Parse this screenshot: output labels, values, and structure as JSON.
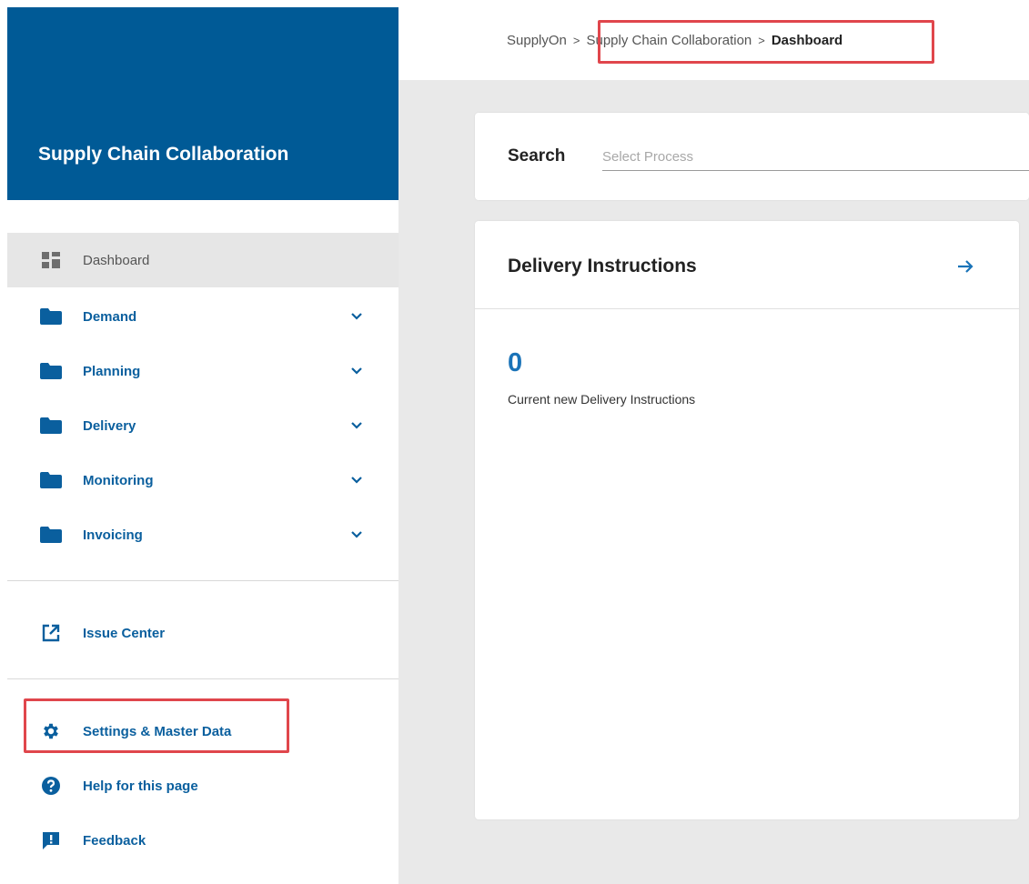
{
  "sidebar": {
    "title": "Supply Chain Collaboration",
    "nav": [
      {
        "label": "Dashboard",
        "icon": "dashboard-icon",
        "active": true
      },
      {
        "label": "Demand",
        "icon": "folder-icon",
        "expandable": true
      },
      {
        "label": "Planning",
        "icon": "folder-icon",
        "expandable": true
      },
      {
        "label": "Delivery",
        "icon": "folder-icon",
        "expandable": true
      },
      {
        "label": "Monitoring",
        "icon": "folder-icon",
        "expandable": true
      },
      {
        "label": "Invoicing",
        "icon": "folder-icon",
        "expandable": true
      }
    ],
    "issue_center": {
      "label": "Issue Center",
      "icon": "external-link-icon"
    },
    "bottom": [
      {
        "label": "Settings & Master Data",
        "icon": "gear-icon"
      },
      {
        "label": "Help for this page",
        "icon": "help-icon"
      },
      {
        "label": "Feedback",
        "icon": "feedback-icon"
      }
    ]
  },
  "breadcrumb": {
    "items": [
      "SupplyOn",
      "Supply Chain Collaboration",
      "Dashboard"
    ],
    "separator": ">"
  },
  "search": {
    "label": "Search",
    "placeholder": "Select Process",
    "value": ""
  },
  "delivery_instructions": {
    "title": "Delivery Instructions",
    "count": "0",
    "caption": "Current new Delivery Instructions",
    "arrow_icon": "arrow-right-icon"
  },
  "colors": {
    "brand_blue": "#005a96",
    "link_blue": "#0a5f9e",
    "count_blue": "#1a73b8",
    "highlight_red": "#e0464c",
    "content_bg": "#e9e9e9"
  }
}
